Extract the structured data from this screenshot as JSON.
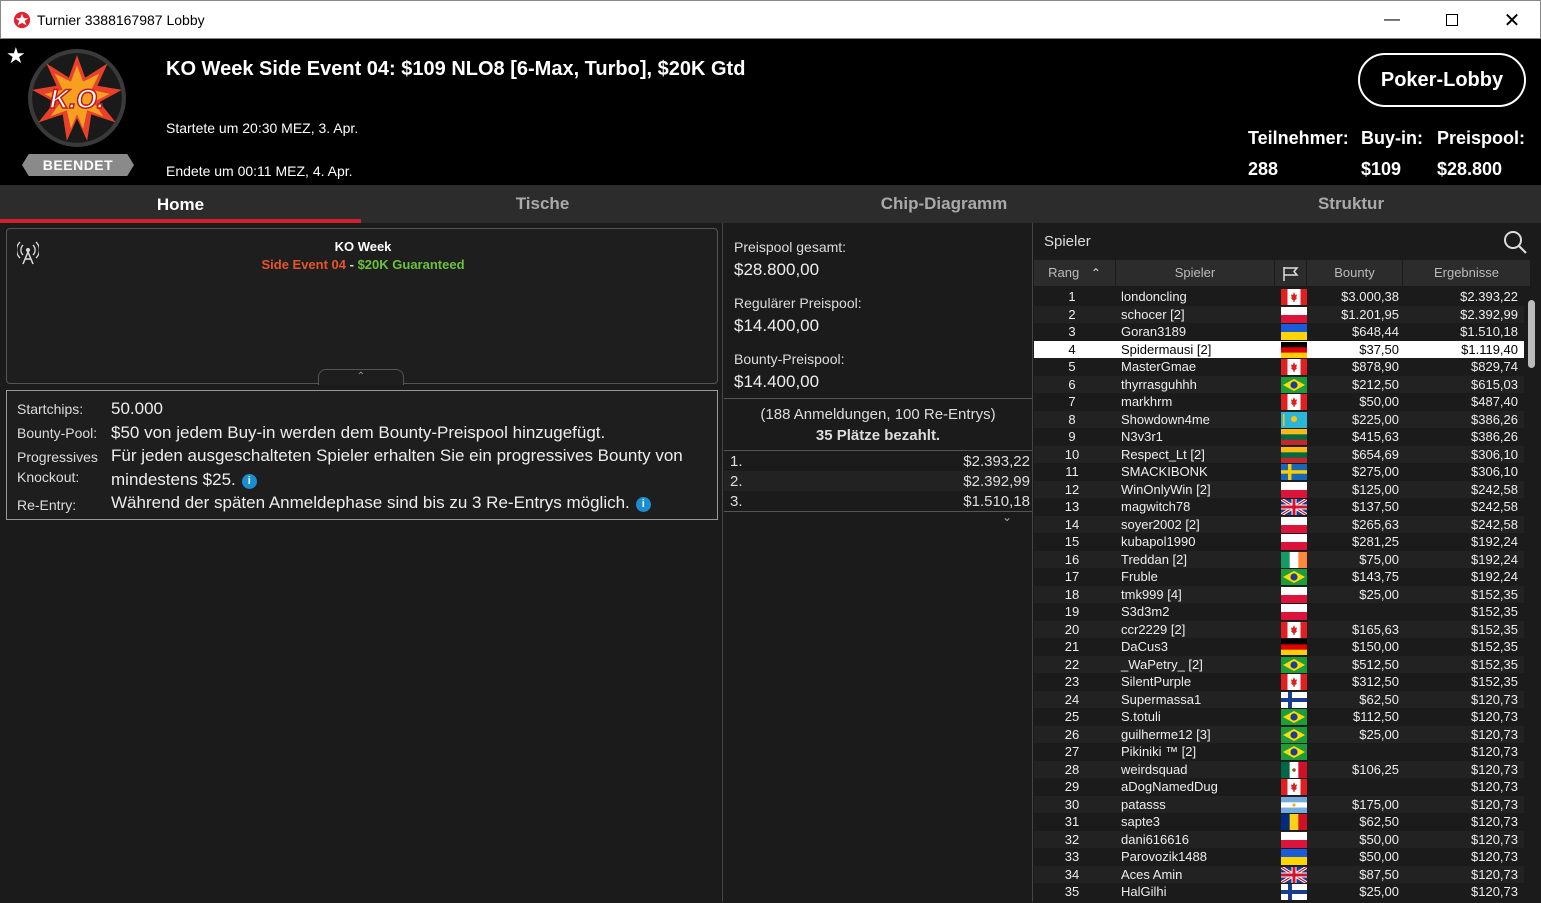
{
  "window": {
    "title": "Turnier 3388167987 Lobby"
  },
  "header": {
    "event_title": "KO Week Side Event 04: $109 NLO8 [6-Max, Turbo], $20K Gtd",
    "started": "Startete um 20:30 MEZ, 3. Apr.",
    "ended": "Endete um 00:11 MEZ, 4. Apr.",
    "status_badge": "BEENDET",
    "lobby_button": "Poker-Lobby",
    "stats": {
      "participants_label": "Teilnehmer:",
      "participants": "288",
      "buyin_label": "Buy-in:",
      "buyin": "$109",
      "prizepool_label": "Preispool:",
      "prizepool": "$28.800"
    }
  },
  "tabs": [
    "Home",
    "Tische",
    "Chip-Diagramm",
    "Struktur"
  ],
  "news": {
    "title": "KO Week",
    "sub_red": "Side Event 04",
    "sub_sep": " - ",
    "sub_green": "$20K Guaranteed"
  },
  "info": {
    "startchips_label": "Startchips:",
    "startchips": "50.000",
    "bounty_label": "Bounty-Pool:",
    "bounty": "$50 von jedem Buy-in werden dem Bounty-Preispool hinzugefügt.",
    "prog_label1": "Progressives",
    "prog_label2": "Knockout:",
    "prog_line1": "Für jeden ausgeschalteten Spieler erhalten Sie ein progressives Bounty von",
    "prog_line2": "mindestens $25.",
    "reentry_label": "Re-Entry:",
    "reentry": "Während der späten Anmeldephase sind bis zu 3 Re-Entrys möglich."
  },
  "prizes": {
    "total_label": "Preispool gesamt:",
    "total": "$28.800,00",
    "regular_label": "Regulärer Preispool:",
    "regular": "$14.400,00",
    "bounty_label": "Bounty-Preispool:",
    "bounty": "$14.400,00",
    "registrations": "(188 Anmeldungen, 100 Re-Entrys)",
    "paid": "35 Plätze bezahlt.",
    "payouts": [
      {
        "place": "1.",
        "amount": "$2.393,22"
      },
      {
        "place": "2.",
        "amount": "$2.392,99"
      },
      {
        "place": "3.",
        "amount": "$1.510,18"
      }
    ]
  },
  "players": {
    "search_label": "Spieler",
    "columns": {
      "rank": "Rang",
      "player": "Spieler",
      "bounty": "Bounty",
      "results": "Ergebnisse"
    },
    "rows": [
      {
        "rank": "1",
        "name": "londoncling",
        "flag": "ca",
        "bounty": "$3.000,38",
        "result": "$2.393,22"
      },
      {
        "rank": "2",
        "name": "schocer [2]",
        "flag": "pl",
        "bounty": "$1.201,95",
        "result": "$2.392,99"
      },
      {
        "rank": "3",
        "name": "Goran3189",
        "flag": "ua",
        "bounty": "$648,44",
        "result": "$1.510,18"
      },
      {
        "rank": "4",
        "name": "Spidermausi [2]",
        "flag": "de",
        "bounty": "$37,50",
        "result": "$1.119,40"
      },
      {
        "rank": "5",
        "name": "MasterGmae",
        "flag": "ca",
        "bounty": "$878,90",
        "result": "$829,74"
      },
      {
        "rank": "6",
        "name": "thyrrasguhhh",
        "flag": "br",
        "bounty": "$212,50",
        "result": "$615,03"
      },
      {
        "rank": "7",
        "name": "markhrm",
        "flag": "ca",
        "bounty": "$50,00",
        "result": "$487,40"
      },
      {
        "rank": "8",
        "name": "Showdown4me",
        "flag": "kz",
        "bounty": "$225,00",
        "result": "$386,26"
      },
      {
        "rank": "9",
        "name": "N3v3r1",
        "flag": "lt",
        "bounty": "$415,63",
        "result": "$386,26"
      },
      {
        "rank": "10",
        "name": "Respect_Lt [2]",
        "flag": "lt",
        "bounty": "$654,69",
        "result": "$306,10"
      },
      {
        "rank": "11",
        "name": "SMACKIBONK",
        "flag": "se",
        "bounty": "$275,00",
        "result": "$306,10"
      },
      {
        "rank": "12",
        "name": "WinOnlyWin [2]",
        "flag": "pl",
        "bounty": "$125,00",
        "result": "$242,58"
      },
      {
        "rank": "13",
        "name": "magwitch78",
        "flag": "gb",
        "bounty": "$137,50",
        "result": "$242,58"
      },
      {
        "rank": "14",
        "name": "soyer2002 [2]",
        "flag": "pl",
        "bounty": "$265,63",
        "result": "$242,58"
      },
      {
        "rank": "15",
        "name": "kubapol1990",
        "flag": "pl",
        "bounty": "$281,25",
        "result": "$192,24"
      },
      {
        "rank": "16",
        "name": "Treddan [2]",
        "flag": "ie",
        "bounty": "$75,00",
        "result": "$192,24"
      },
      {
        "rank": "17",
        "name": "Fruble",
        "flag": "br",
        "bounty": "$143,75",
        "result": "$192,24"
      },
      {
        "rank": "18",
        "name": "tmk999 [4]",
        "flag": "pl",
        "bounty": "$25,00",
        "result": "$152,35"
      },
      {
        "rank": "19",
        "name": "S3d3m2",
        "flag": "pl",
        "bounty": "",
        "result": "$152,35"
      },
      {
        "rank": "20",
        "name": "ccr2229 [2]",
        "flag": "ca",
        "bounty": "$165,63",
        "result": "$152,35"
      },
      {
        "rank": "21",
        "name": "DaCus3",
        "flag": "de",
        "bounty": "$150,00",
        "result": "$152,35"
      },
      {
        "rank": "22",
        "name": "_WaPetry_ [2]",
        "flag": "br",
        "bounty": "$512,50",
        "result": "$152,35"
      },
      {
        "rank": "23",
        "name": "SilentPurple",
        "flag": "ca",
        "bounty": "$312,50",
        "result": "$152,35"
      },
      {
        "rank": "24",
        "name": "Supermassa1",
        "flag": "fi",
        "bounty": "$62,50",
        "result": "$120,73"
      },
      {
        "rank": "25",
        "name": "S.totuli",
        "flag": "br",
        "bounty": "$112,50",
        "result": "$120,73"
      },
      {
        "rank": "26",
        "name": "guilherme12 [3]",
        "flag": "br",
        "bounty": "$25,00",
        "result": "$120,73"
      },
      {
        "rank": "27",
        "name": "Pikiniki ™ [2]",
        "flag": "br",
        "bounty": "",
        "result": "$120,73"
      },
      {
        "rank": "28",
        "name": "weirdsquad",
        "flag": "mx",
        "bounty": "$106,25",
        "result": "$120,73"
      },
      {
        "rank": "29",
        "name": "aDogNamedDug",
        "flag": "ca",
        "bounty": "",
        "result": "$120,73"
      },
      {
        "rank": "30",
        "name": "patasss",
        "flag": "ar",
        "bounty": "$175,00",
        "result": "$120,73"
      },
      {
        "rank": "31",
        "name": "sapte3",
        "flag": "ro",
        "bounty": "$62,50",
        "result": "$120,73"
      },
      {
        "rank": "32",
        "name": "dani616616",
        "flag": "pl",
        "bounty": "$50,00",
        "result": "$120,73"
      },
      {
        "rank": "33",
        "name": "Parovozik1488",
        "flag": "ua",
        "bounty": "$50,00",
        "result": "$120,73"
      },
      {
        "rank": "34",
        "name": "Aces Amin",
        "flag": "gb",
        "bounty": "$87,50",
        "result": "$120,73"
      },
      {
        "rank": "35",
        "name": "HalGilhi",
        "flag": "fi",
        "bounty": "$25,00",
        "result": "$120,73"
      }
    ]
  },
  "colors": {
    "accent_red": "#d0202b",
    "news_red": "#e8542a",
    "news_green": "#6cc13a",
    "info_blue": "#1a8ed1"
  }
}
